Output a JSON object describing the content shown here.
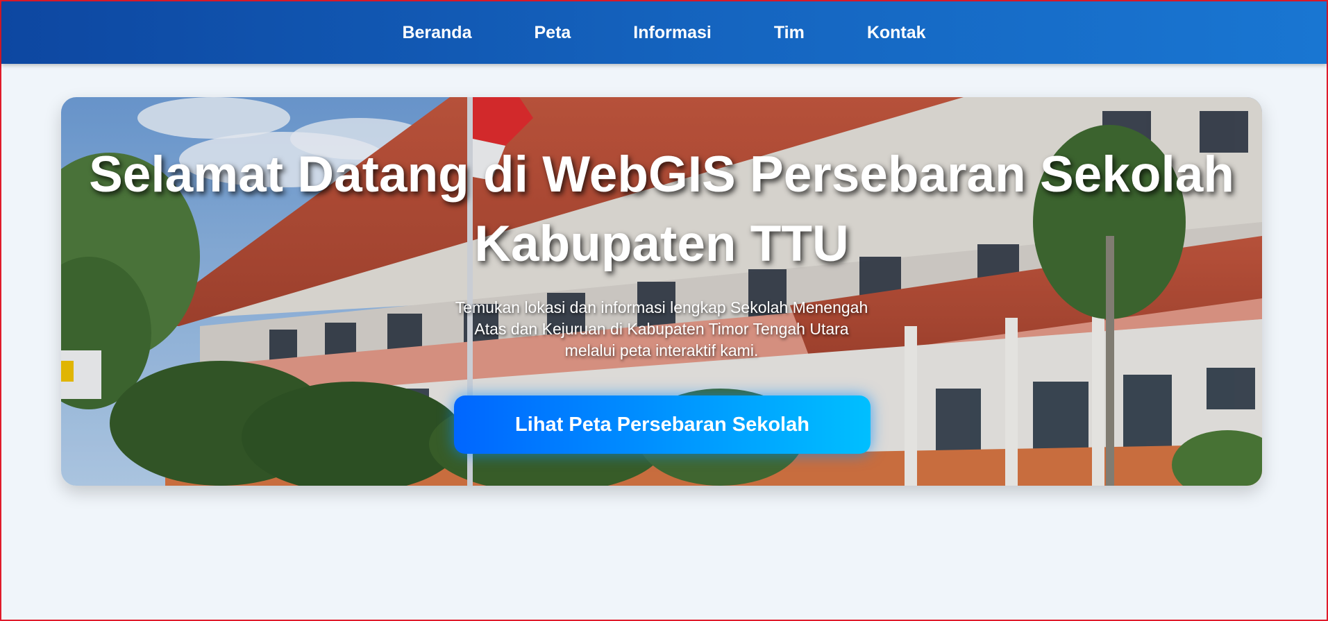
{
  "nav": {
    "items": [
      {
        "label": "Beranda"
      },
      {
        "label": "Peta"
      },
      {
        "label": "Informasi"
      },
      {
        "label": "Tim"
      },
      {
        "label": "Kontak"
      }
    ]
  },
  "hero": {
    "title": "Selamat Datang di WebGIS Persebaran Sekolah Kabupaten TTU",
    "subtitle": "Temukan lokasi dan informasi lengkap Sekolah Menengah Atas dan Kejuruan di Kabupaten Timor Tengah Utara melalui peta interaktif kami.",
    "cta_label": "Lihat Peta Persebaran Sekolah",
    "background_image": "school-building-photo"
  },
  "colors": {
    "nav_start": "#0d47a1",
    "nav_end": "#1976d2",
    "page_bg": "#f0f5fa",
    "button_start": "#0066ff",
    "button_end": "#00bfff"
  }
}
